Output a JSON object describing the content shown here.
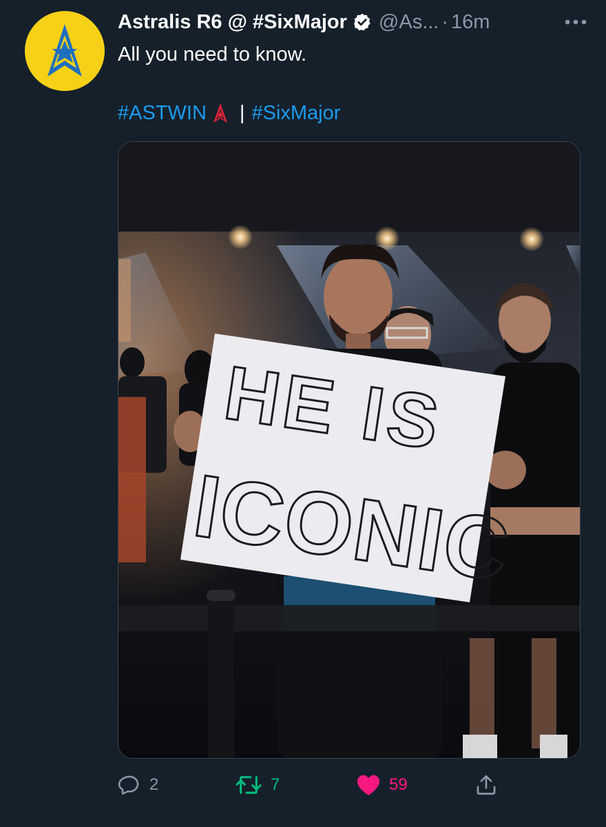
{
  "tweet": {
    "display_name": "Astralis R6 @ #SixMajor",
    "handle": "@As...",
    "separator": "·",
    "time": "16m",
    "text": "All you need to know.",
    "hashtag_1": "#ASTWIN",
    "hashtag_sep": "|",
    "hashtag_2": "#SixMajor",
    "image": {
      "sign_line_1": "HE IS",
      "sign_line_2": "ICONIC"
    }
  },
  "actions": {
    "reply_count": "2",
    "retweet_count": "7",
    "like_count": "59"
  },
  "colors": {
    "background": "#15202b",
    "link": "#1d9bf0",
    "muted": "#8b98a5",
    "retweet": "#00ba7c",
    "like": "#f91880",
    "avatar": "#f7d117"
  },
  "icons": [
    "astralis-logo-icon",
    "verified-badge-icon",
    "more-icon",
    "astralis-emoji-icon",
    "reply-icon",
    "retweet-icon",
    "like-icon",
    "share-icon"
  ]
}
